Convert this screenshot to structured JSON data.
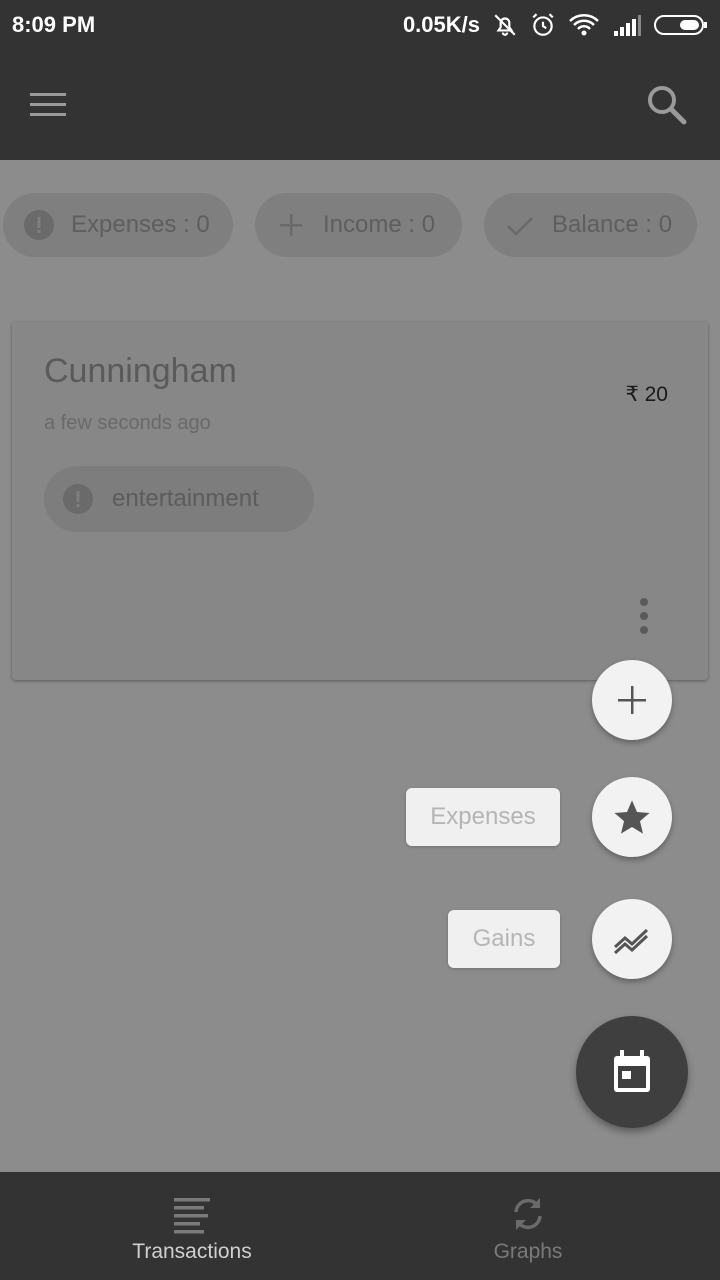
{
  "status_bar": {
    "time": "8:09 PM",
    "net_speed": "0.05K/s",
    "icons": [
      "bell-muted-icon",
      "alarm-icon",
      "wifi-icon",
      "signal-icon",
      "battery-icon"
    ]
  },
  "app_bar": {
    "icons": [
      "menu-icon",
      "search-icon"
    ]
  },
  "summary": {
    "expenses": "Expenses : 0",
    "income": "Income : 0",
    "balance": "Balance : 0"
  },
  "transaction": {
    "title": "Cunningham",
    "amount": "₹ 20",
    "time": "a few seconds ago",
    "category": "entertainment"
  },
  "fab_menu": {
    "expenses_label": "Expenses",
    "gains_label": "Gains"
  },
  "bottom_nav": {
    "transactions": "Transactions",
    "graphs": "Graphs"
  },
  "colors": {
    "bar": "#333333",
    "scrim": "#8c8c8c",
    "fab": "#f2f2f2",
    "fab_main": "#3f3f3f"
  }
}
